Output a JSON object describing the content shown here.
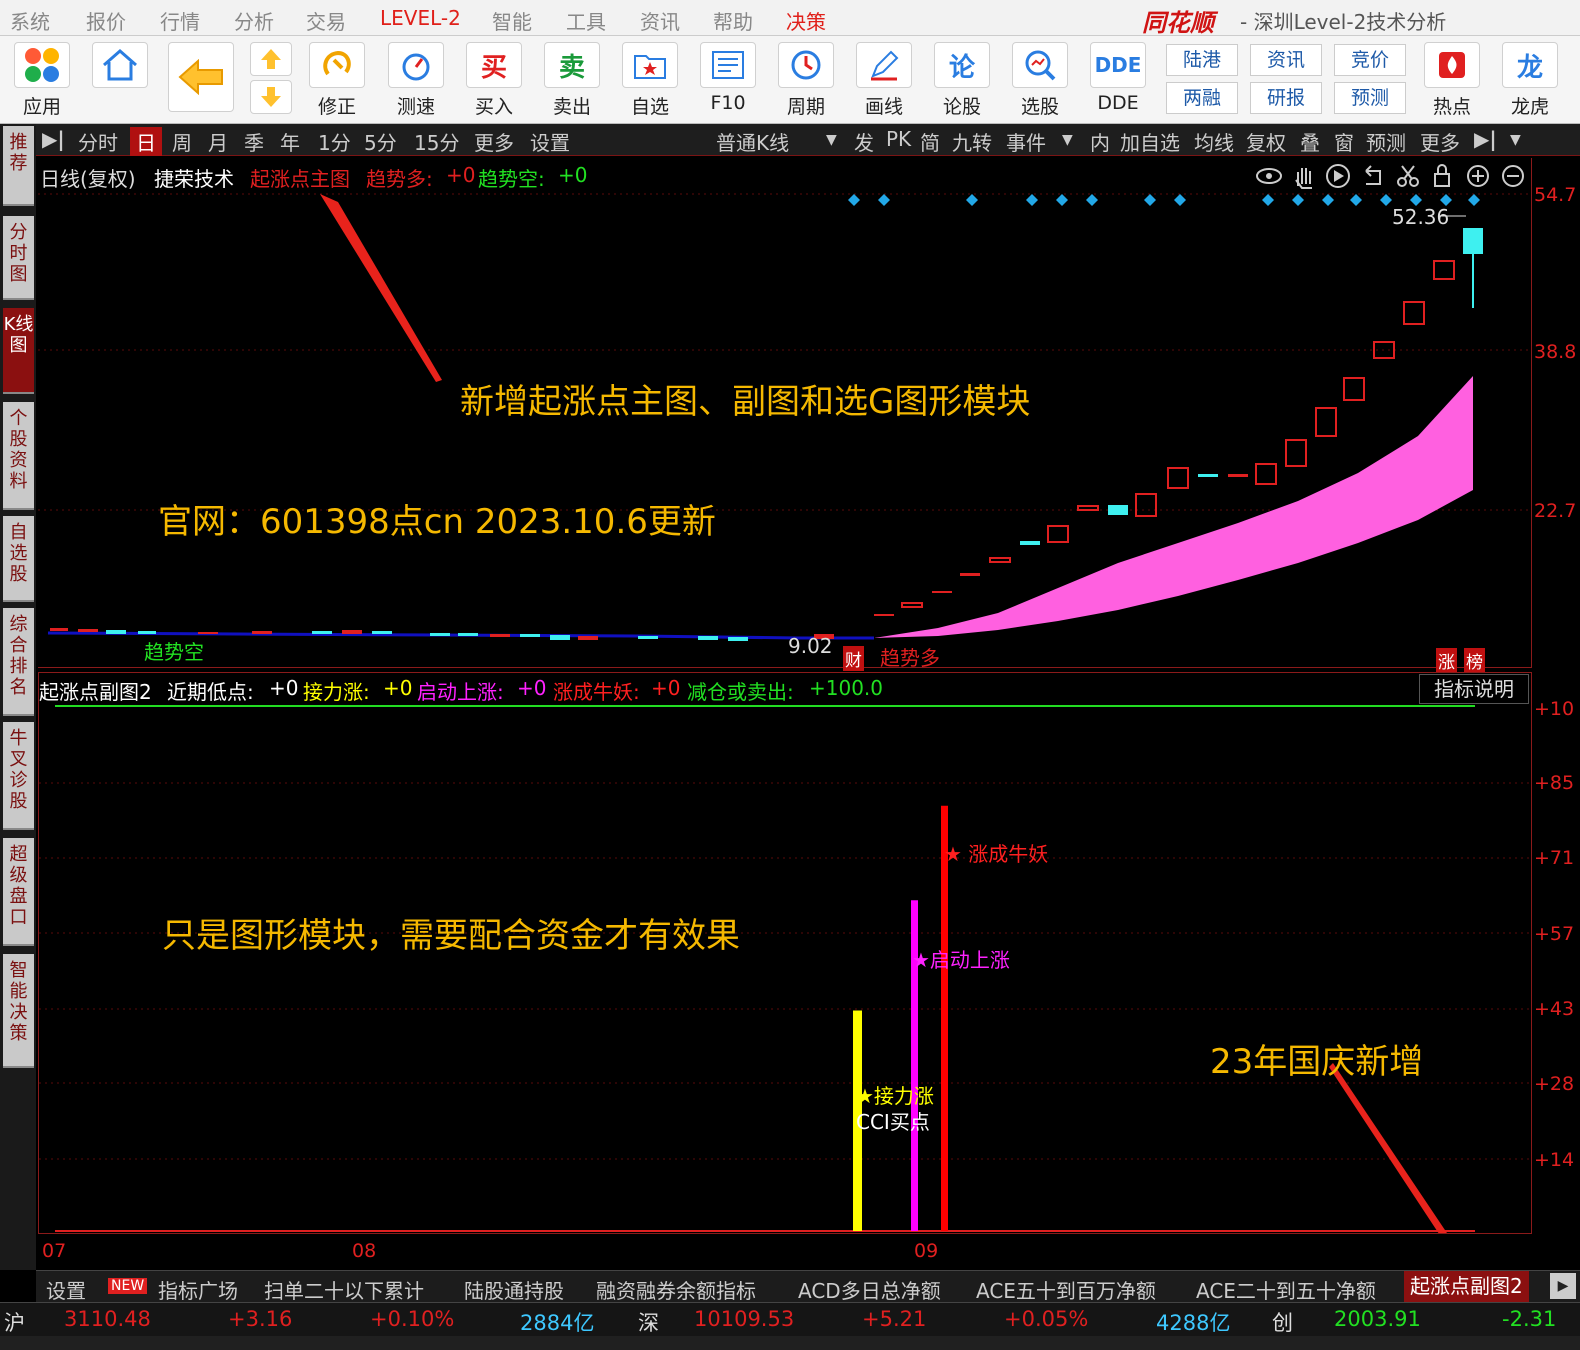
{
  "menubar": {
    "items": [
      "系统",
      "报价",
      "行情",
      "分析",
      "交易",
      "LEVEL-2",
      "智能",
      "工具",
      "资讯",
      "帮助",
      "决策"
    ],
    "brand": "同花顺",
    "title": "- 深圳Level-2技术分析"
  },
  "toolbar": {
    "tools": [
      {
        "label": "应用",
        "icon": "apps-icon"
      },
      {
        "label": "",
        "icon": "home-icon"
      },
      {
        "label": "",
        "icon": "back-arrow-icon"
      },
      {
        "label": "",
        "icon": "up-down-arrows-icon"
      },
      {
        "label": "修正",
        "icon": "fix-icon"
      },
      {
        "label": "测速",
        "icon": "speed-icon"
      },
      {
        "label": "买入",
        "icon": "buy-icon"
      },
      {
        "label": "卖出",
        "icon": "sell-icon"
      },
      {
        "label": "自选",
        "icon": "watchlist-icon"
      },
      {
        "label": "F10",
        "icon": "f10-icon"
      },
      {
        "label": "周期",
        "icon": "period-icon"
      },
      {
        "label": "画线",
        "icon": "draw-icon"
      },
      {
        "label": "论股",
        "icon": "discuss-icon"
      },
      {
        "label": "选股",
        "icon": "pick-icon"
      },
      {
        "label": "DDE",
        "icon": "dde-icon"
      }
    ],
    "quick": [
      "陆港",
      "资讯",
      "竞价",
      "两融",
      "研报",
      "预测"
    ],
    "right": [
      {
        "label": "热点",
        "icon": "hot-icon"
      },
      {
        "label": "龙虎",
        "icon": "dragon-icon"
      }
    ],
    "glyphs": {
      "buy": "买",
      "sell": "卖",
      "discuss": "论",
      "dde": "DDE",
      "dragon": "龙"
    }
  },
  "leftnav": [
    "推荐",
    "分时图",
    "K线图",
    "个股资料",
    "自选股",
    "综合排名",
    "牛叉诊股",
    "超级盘口",
    "智能决策"
  ],
  "period_tabs": [
    "分时",
    "日",
    "周",
    "月",
    "季",
    "年",
    "1分",
    "5分",
    "15分",
    "更多",
    "设置"
  ],
  "kline_type": "普通K线",
  "right_tabs": [
    "发",
    "PK",
    "简",
    "九转",
    "事件",
    "内",
    "加自选",
    "均线",
    "复权",
    "叠",
    "窗",
    "预测",
    "更多"
  ],
  "main_chart": {
    "header": {
      "period": "日线(复权)",
      "stock": "捷荣技术",
      "indicator": "起涨点主图",
      "bull_label": "趋势多:",
      "bull_value": "+0",
      "bear_label": "趋势空:",
      "bear_value": "+0"
    },
    "y_ticks": [
      "54.7",
      "38.8",
      "22.7"
    ],
    "price_high_label": "52.36",
    "price_low_label": "9.02",
    "bear_marker": "趋势空",
    "bull_marker": "趋势多",
    "cai_badge": "财",
    "right_badges": [
      "涨",
      "榜"
    ],
    "annotation1": "新增起涨点主图、副图和选G图形模块",
    "annotation2": "官网：601398点cn  2023.10.6更新"
  },
  "sub_chart": {
    "header": {
      "name": "起涨点副图2",
      "i1": "近期低点:",
      "v1": "+0",
      "i2": "接力涨:",
      "v2": "+0",
      "i3": "启动上涨:",
      "v3": "+0",
      "i4": "涨成牛妖:",
      "v4": "+0",
      "i5": "减仓或卖出:",
      "v5": "+100.0"
    },
    "explain_button": "指标说明",
    "y_ticks": [
      "+10",
      "+85",
      "+71",
      "+57",
      "+43",
      "+28",
      "+14"
    ],
    "labels": {
      "relay": "★接力涨",
      "cci": "CCI买点",
      "start": "★启动上涨",
      "monster": "★ 涨成牛妖"
    },
    "annotation3": "只是图形模块，需要配合资金才有效果",
    "annotation4": "23年国庆新增",
    "x_ticks": [
      "07",
      "08",
      "09"
    ]
  },
  "chart_data": {
    "type": "bar",
    "categories": [
      "接力涨",
      "启动上涨",
      "涨成牛妖"
    ],
    "series": [
      {
        "name": "接力涨",
        "values": [
          42
        ]
      },
      {
        "name": "启动上涨",
        "values": [
          63
        ]
      },
      {
        "name": "涨成牛妖",
        "values": [
          81
        ]
      }
    ],
    "colors": [
      "#ffff00",
      "#ff00ff",
      "#ff0000"
    ]
  },
  "bottom_tabs": [
    "设置",
    "NEW",
    "指标广场",
    "扫单二十以下累计",
    "陆股通持股",
    "融资融券余额指标",
    "ACD多日总净额",
    "ACE五十到百万净额",
    "ACE二十到五十净额",
    "起涨点副图2"
  ],
  "status": {
    "sh_name": "沪",
    "sh_index": "3110.48",
    "sh_chg": "+3.16",
    "sh_pct": "+0.10%",
    "sh_amt": "2884亿",
    "sz_name": "深",
    "sz_index": "10109.53",
    "sz_chg": "+5.21",
    "sz_pct": "+0.05%",
    "sz_amt": "4288亿",
    "cy_name": "创",
    "cy_index": "2003.91",
    "cy_chg": "-2.31"
  }
}
